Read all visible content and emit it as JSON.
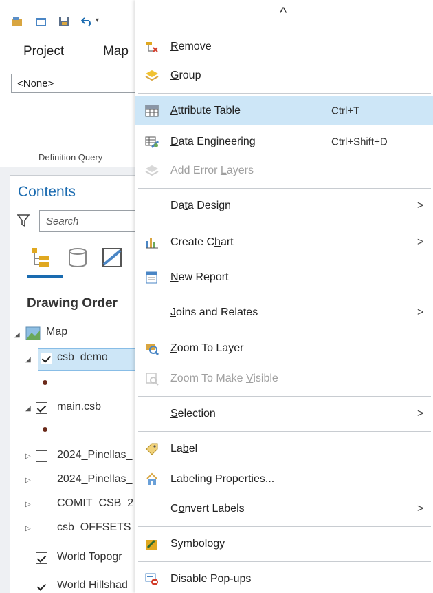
{
  "colors": {
    "accent": "#1a6bb0",
    "highlight": "#cde6f7",
    "disabled": "#a0a0a0"
  },
  "ribbon": {
    "tabs": [
      "Project",
      "Map"
    ],
    "definition_query_value": "<None>",
    "definition_query_label": "Definition Query"
  },
  "contents": {
    "title": "Contents",
    "search_placeholder": "Search",
    "section_title": "Drawing Order",
    "tree": [
      {
        "label": "Map",
        "checked": null
      },
      {
        "label": "csb_demo",
        "checked": true
      },
      {
        "label": "main.csb",
        "checked": true
      },
      {
        "label": "2024_Pinellas_",
        "checked": false
      },
      {
        "label": "2024_Pinellas_",
        "checked": false
      },
      {
        "label": "COMIT_CSB_2",
        "checked": false
      },
      {
        "label": "csb_OFFSETS_",
        "checked": false
      },
      {
        "label": "World Topogr",
        "checked": true
      },
      {
        "label": "World Hillshad",
        "checked": true
      }
    ]
  },
  "menu": {
    "scroll_up_glyph": "^",
    "items": [
      {
        "label": "Remove",
        "icon": "remove-layer-icon"
      },
      {
        "label": "Group",
        "icon": "group-layers-icon"
      },
      {
        "label": "Attribute Table",
        "shortcut": "Ctrl+T",
        "icon": "attribute-table-icon",
        "highlighted": true
      },
      {
        "label": "Data Engineering",
        "shortcut": "Ctrl+Shift+D",
        "icon": "data-engineering-icon"
      },
      {
        "label": "Add Error Layers",
        "icon": "error-layers-icon",
        "disabled": true
      },
      {
        "label": "Data Design",
        "submenu": true
      },
      {
        "label": "Create Chart",
        "icon": "chart-icon",
        "submenu": true
      },
      {
        "label": "New Report",
        "icon": "report-icon"
      },
      {
        "label": "Joins and Relates",
        "submenu": true
      },
      {
        "label": "Zoom To Layer",
        "icon": "zoom-layer-icon"
      },
      {
        "label": "Zoom To Make Visible",
        "icon": "zoom-visible-icon",
        "disabled": true
      },
      {
        "label": "Selection",
        "submenu": true
      },
      {
        "label": "Label",
        "icon": "label-icon"
      },
      {
        "label": "Labeling Properties...",
        "icon": "labeling-properties-icon"
      },
      {
        "label": "Convert Labels",
        "submenu": true
      },
      {
        "label": "Symbology",
        "icon": "symbology-icon"
      },
      {
        "label": "Disable Pop-ups",
        "icon": "disable-popups-icon"
      }
    ],
    "submenu_arrow": ">"
  }
}
